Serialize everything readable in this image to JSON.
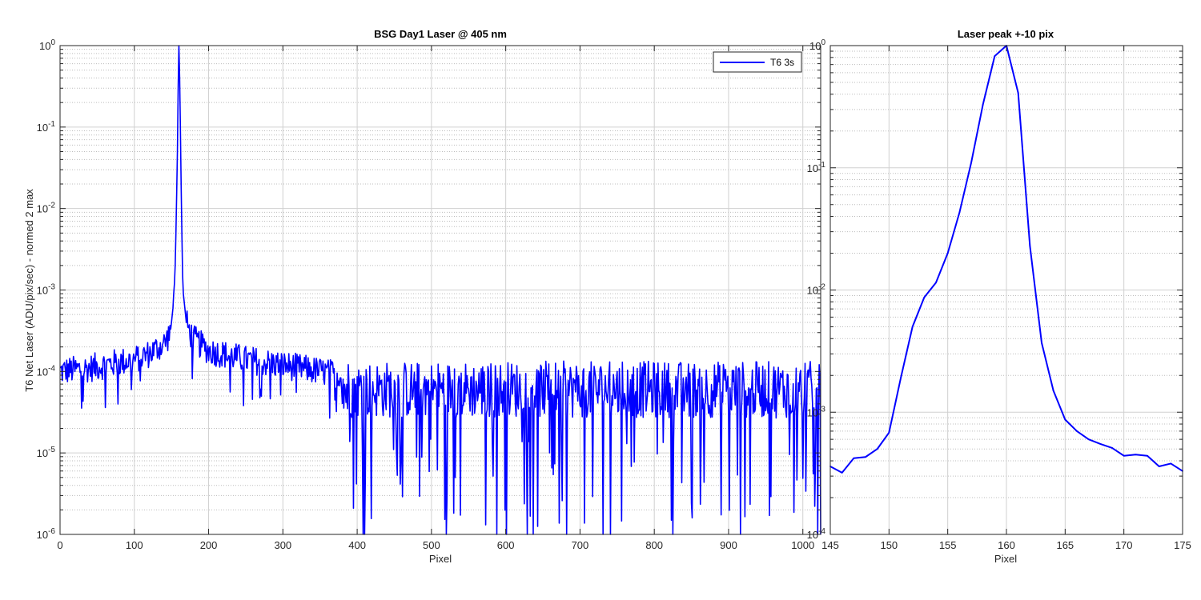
{
  "chart_data": [
    {
      "type": "line",
      "title": "BSG  Day1 Laser @ 405 nm",
      "xlabel": "Pixel",
      "ylabel": "T6 Net Laser (ADU/pix/sec) - normed 2 max",
      "xlim": [
        0,
        1024
      ],
      "ylim": [
        1e-06,
        1
      ],
      "yscale": "log",
      "grid": "major+minor",
      "legend_position": "top-right",
      "xticks": [
        "0",
        "100",
        "200",
        "300",
        "400",
        "500",
        "600",
        "700",
        "800",
        "900",
        "1000"
      ],
      "yticks": [
        {
          "base": "10",
          "exp": "-6"
        },
        {
          "base": "10",
          "exp": "-5"
        },
        {
          "base": "10",
          "exp": "-4"
        },
        {
          "base": "10",
          "exp": "-3"
        },
        {
          "base": "10",
          "exp": "-2"
        },
        {
          "base": "10",
          "exp": "-1"
        },
        {
          "base": "10",
          "exp": "0"
        }
      ],
      "series": [
        {
          "name": "T6 3s",
          "color": "#0000ff",
          "description_points": {
            "x": [
              0,
              20,
              40,
              60,
              80,
              100,
              120,
              130,
              140,
              145,
              148,
              150,
              152,
              153,
              154,
              155,
              156,
              157,
              158,
              159,
              160,
              161,
              162,
              163,
              164,
              165,
              166,
              168,
              170,
              175,
              180,
              200,
              250,
              300,
              350,
              380
            ],
            "y": [
              0.0001,
              0.000105,
              0.00011,
              0.00012,
              0.00013,
              0.00014,
              0.000165,
              0.00019,
              0.00022,
              0.00026,
              0.00032,
              0.0004,
              0.0006,
              0.0009,
              0.0012,
              0.002,
              0.005,
              0.015,
              0.05,
              0.3,
              1.0,
              0.4,
              0.1,
              0.02,
              0.005,
              0.0015,
              0.0009,
              0.0006,
              0.0004,
              0.0003,
              0.00025,
              0.00018,
              0.00014,
              0.00012,
              0.0001,
              9e-05
            ]
          },
          "noise_floor": {
            "x_range": [
              380,
              1024
            ],
            "typical": 6e-05,
            "min": 1e-06
          }
        }
      ]
    },
    {
      "type": "line",
      "title": "Laser peak +-10 pix",
      "xlabel": "Pixel",
      "ylabel": "",
      "xlim": [
        145,
        175
      ],
      "ylim": [
        0.0001,
        1
      ],
      "yscale": "log",
      "grid": "major+minor",
      "xticks": [
        "145",
        "150",
        "155",
        "160",
        "165",
        "170",
        "175"
      ],
      "yticks": [
        {
          "base": "10",
          "exp": "-4"
        },
        {
          "base": "10",
          "exp": "-3"
        },
        {
          "base": "10",
          "exp": "-2"
        },
        {
          "base": "10",
          "exp": "-1"
        },
        {
          "base": "10",
          "exp": "0"
        }
      ],
      "series": [
        {
          "name": "",
          "color": "#0000ff",
          "x": [
            145,
            146,
            147,
            148,
            149,
            150,
            151,
            152,
            153,
            154,
            155,
            156,
            157,
            158,
            159,
            160,
            161,
            162,
            163,
            164,
            165,
            166,
            167,
            168,
            169,
            170,
            171,
            172,
            173,
            174,
            175
          ],
          "y": [
            0.00036,
            0.00032,
            0.00042,
            0.00043,
            0.0005,
            0.00068,
            0.0019,
            0.005,
            0.0087,
            0.0115,
            0.02,
            0.043,
            0.11,
            0.33,
            0.82,
            1.0,
            0.41,
            0.023,
            0.0037,
            0.0015,
            0.00087,
            0.0007,
            0.0006,
            0.00055,
            0.00051,
            0.00044,
            0.00045,
            0.00044,
            0.00036,
            0.00038,
            0.00033
          ]
        }
      ]
    }
  ]
}
